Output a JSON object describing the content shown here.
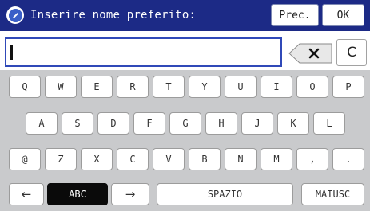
{
  "header": {
    "icon": "pencil-icon",
    "title": "Inserire nome preferito:",
    "prev_label": "Prec.",
    "ok_label": "OK"
  },
  "input": {
    "value": ""
  },
  "controls": {
    "backspace_icon": "backspace-icon",
    "clear_label": "C"
  },
  "keyboard": {
    "row1": [
      "Q",
      "W",
      "E",
      "R",
      "T",
      "Y",
      "U",
      "I",
      "O",
      "P"
    ],
    "row2": [
      "A",
      "S",
      "D",
      "F",
      "G",
      "H",
      "J",
      "K",
      "L"
    ],
    "row3": [
      "@",
      "Z",
      "X",
      "C",
      "V",
      "B",
      "N",
      "M",
      ",",
      "."
    ],
    "bottom": {
      "left_arrow": "←",
      "abc_label": "ABC",
      "right_arrow": "→",
      "space_label": "SPAZIO",
      "shift_label": "MAIUSC"
    }
  },
  "colors": {
    "header": "#1c2a86",
    "keyboard_bg": "#c9cacc",
    "input_border": "#3049b8"
  }
}
